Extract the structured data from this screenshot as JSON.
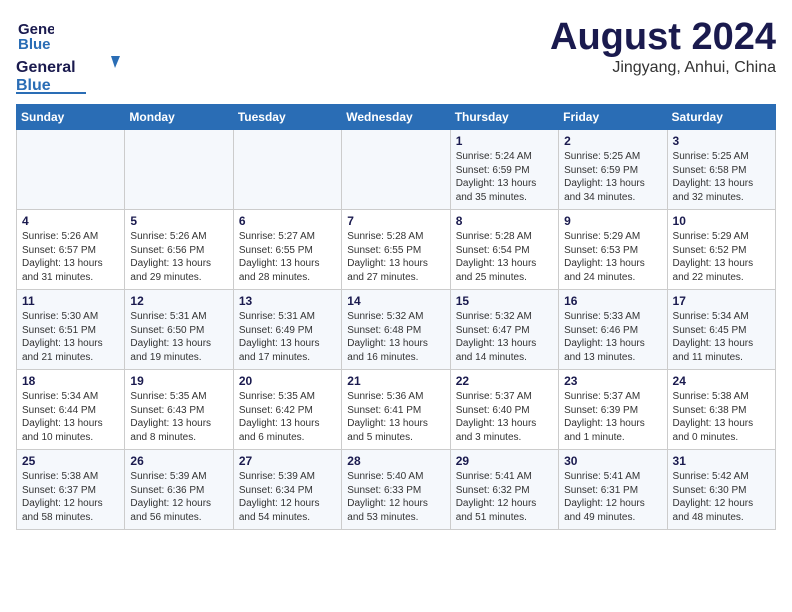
{
  "header": {
    "logo_line1": "General",
    "logo_line2": "Blue",
    "title": "August 2024",
    "subtitle": "Jingyang, Anhui, China"
  },
  "weekdays": [
    "Sunday",
    "Monday",
    "Tuesday",
    "Wednesday",
    "Thursday",
    "Friday",
    "Saturday"
  ],
  "weeks": [
    [
      {
        "day": "",
        "info": ""
      },
      {
        "day": "",
        "info": ""
      },
      {
        "day": "",
        "info": ""
      },
      {
        "day": "",
        "info": ""
      },
      {
        "day": "1",
        "info": "Sunrise: 5:24 AM\nSunset: 6:59 PM\nDaylight: 13 hours\nand 35 minutes."
      },
      {
        "day": "2",
        "info": "Sunrise: 5:25 AM\nSunset: 6:59 PM\nDaylight: 13 hours\nand 34 minutes."
      },
      {
        "day": "3",
        "info": "Sunrise: 5:25 AM\nSunset: 6:58 PM\nDaylight: 13 hours\nand 32 minutes."
      }
    ],
    [
      {
        "day": "4",
        "info": "Sunrise: 5:26 AM\nSunset: 6:57 PM\nDaylight: 13 hours\nand 31 minutes."
      },
      {
        "day": "5",
        "info": "Sunrise: 5:26 AM\nSunset: 6:56 PM\nDaylight: 13 hours\nand 29 minutes."
      },
      {
        "day": "6",
        "info": "Sunrise: 5:27 AM\nSunset: 6:55 PM\nDaylight: 13 hours\nand 28 minutes."
      },
      {
        "day": "7",
        "info": "Sunrise: 5:28 AM\nSunset: 6:55 PM\nDaylight: 13 hours\nand 27 minutes."
      },
      {
        "day": "8",
        "info": "Sunrise: 5:28 AM\nSunset: 6:54 PM\nDaylight: 13 hours\nand 25 minutes."
      },
      {
        "day": "9",
        "info": "Sunrise: 5:29 AM\nSunset: 6:53 PM\nDaylight: 13 hours\nand 24 minutes."
      },
      {
        "day": "10",
        "info": "Sunrise: 5:29 AM\nSunset: 6:52 PM\nDaylight: 13 hours\nand 22 minutes."
      }
    ],
    [
      {
        "day": "11",
        "info": "Sunrise: 5:30 AM\nSunset: 6:51 PM\nDaylight: 13 hours\nand 21 minutes."
      },
      {
        "day": "12",
        "info": "Sunrise: 5:31 AM\nSunset: 6:50 PM\nDaylight: 13 hours\nand 19 minutes."
      },
      {
        "day": "13",
        "info": "Sunrise: 5:31 AM\nSunset: 6:49 PM\nDaylight: 13 hours\nand 17 minutes."
      },
      {
        "day": "14",
        "info": "Sunrise: 5:32 AM\nSunset: 6:48 PM\nDaylight: 13 hours\nand 16 minutes."
      },
      {
        "day": "15",
        "info": "Sunrise: 5:32 AM\nSunset: 6:47 PM\nDaylight: 13 hours\nand 14 minutes."
      },
      {
        "day": "16",
        "info": "Sunrise: 5:33 AM\nSunset: 6:46 PM\nDaylight: 13 hours\nand 13 minutes."
      },
      {
        "day": "17",
        "info": "Sunrise: 5:34 AM\nSunset: 6:45 PM\nDaylight: 13 hours\nand 11 minutes."
      }
    ],
    [
      {
        "day": "18",
        "info": "Sunrise: 5:34 AM\nSunset: 6:44 PM\nDaylight: 13 hours\nand 10 minutes."
      },
      {
        "day": "19",
        "info": "Sunrise: 5:35 AM\nSunset: 6:43 PM\nDaylight: 13 hours\nand 8 minutes."
      },
      {
        "day": "20",
        "info": "Sunrise: 5:35 AM\nSunset: 6:42 PM\nDaylight: 13 hours\nand 6 minutes."
      },
      {
        "day": "21",
        "info": "Sunrise: 5:36 AM\nSunset: 6:41 PM\nDaylight: 13 hours\nand 5 minutes."
      },
      {
        "day": "22",
        "info": "Sunrise: 5:37 AM\nSunset: 6:40 PM\nDaylight: 13 hours\nand 3 minutes."
      },
      {
        "day": "23",
        "info": "Sunrise: 5:37 AM\nSunset: 6:39 PM\nDaylight: 13 hours\nand 1 minute."
      },
      {
        "day": "24",
        "info": "Sunrise: 5:38 AM\nSunset: 6:38 PM\nDaylight: 13 hours\nand 0 minutes."
      }
    ],
    [
      {
        "day": "25",
        "info": "Sunrise: 5:38 AM\nSunset: 6:37 PM\nDaylight: 12 hours\nand 58 minutes."
      },
      {
        "day": "26",
        "info": "Sunrise: 5:39 AM\nSunset: 6:36 PM\nDaylight: 12 hours\nand 56 minutes."
      },
      {
        "day": "27",
        "info": "Sunrise: 5:39 AM\nSunset: 6:34 PM\nDaylight: 12 hours\nand 54 minutes."
      },
      {
        "day": "28",
        "info": "Sunrise: 5:40 AM\nSunset: 6:33 PM\nDaylight: 12 hours\nand 53 minutes."
      },
      {
        "day": "29",
        "info": "Sunrise: 5:41 AM\nSunset: 6:32 PM\nDaylight: 12 hours\nand 51 minutes."
      },
      {
        "day": "30",
        "info": "Sunrise: 5:41 AM\nSunset: 6:31 PM\nDaylight: 12 hours\nand 49 minutes."
      },
      {
        "day": "31",
        "info": "Sunrise: 5:42 AM\nSunset: 6:30 PM\nDaylight: 12 hours\nand 48 minutes."
      }
    ]
  ]
}
